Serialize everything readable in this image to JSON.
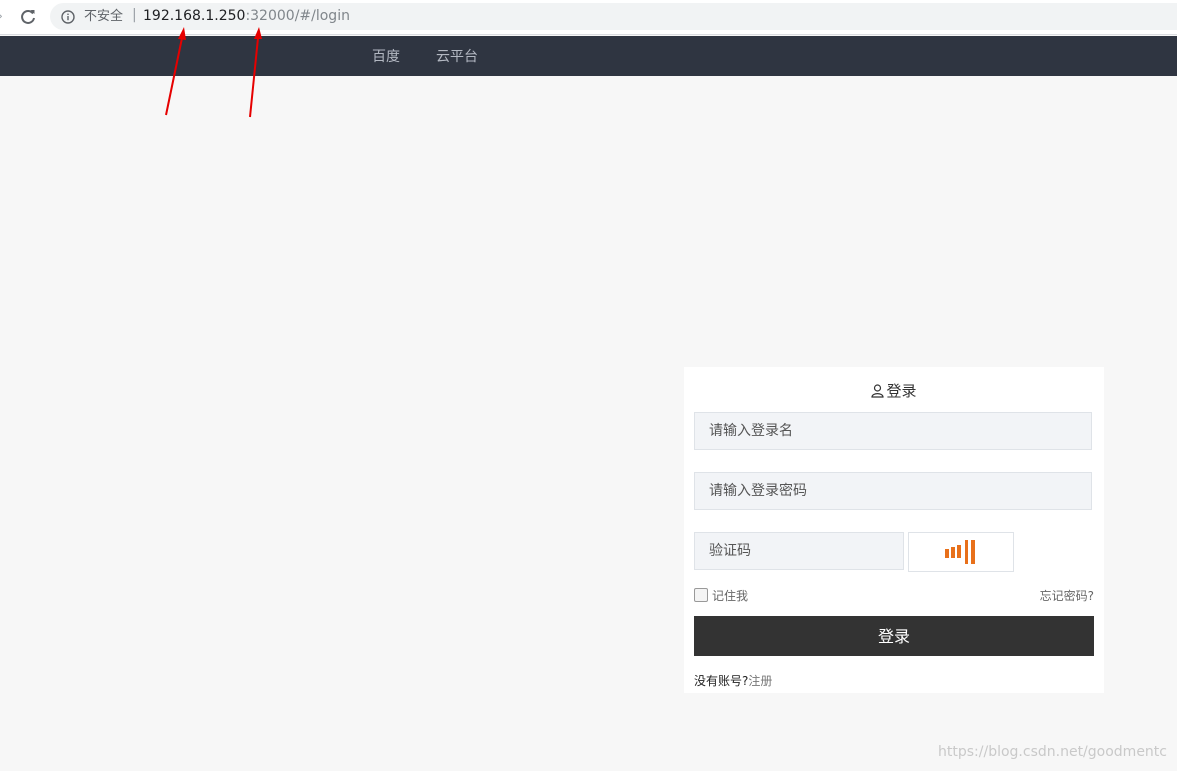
{
  "browser": {
    "security_label": "不安全",
    "separator": "|",
    "url_host": "192.168.1.250",
    "url_rest": ":32000/#/login"
  },
  "site_nav": {
    "links": [
      {
        "label": "百度"
      },
      {
        "label": "云平台"
      }
    ]
  },
  "login": {
    "title": "登录",
    "username_placeholder": "请输入登录名",
    "password_placeholder": "请输入登录密码",
    "captcha_placeholder": "验证码",
    "remember_label": "记住我",
    "forgot_label": "忘记密码?",
    "submit_label": "登录",
    "no_account_text": "没有账号?",
    "register_label": "注册"
  },
  "watermark": "https://blog.csdn.net/goodmentc",
  "colors": {
    "nav_bg": "#2f3541",
    "button_bg": "#333333",
    "captcha_accent": "#e8701a",
    "annotation": "#e60000"
  }
}
